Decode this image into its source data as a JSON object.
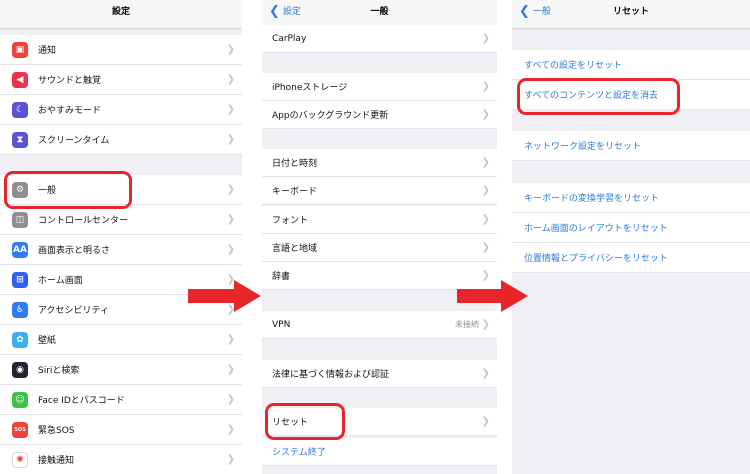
{
  "panel1": {
    "title": "設定",
    "rows": [
      {
        "label": "通知",
        "icon": "notifications-icon",
        "color": "#f0413a",
        "glyph": "▣"
      },
      {
        "label": "サウンドと触覚",
        "icon": "sound-icon",
        "color": "#f0304f",
        "glyph": "◀"
      },
      {
        "label": "おやすみモード",
        "icon": "moon-icon",
        "color": "#5b55d6",
        "glyph": "☾"
      },
      {
        "label": "スクリーンタイム",
        "icon": "hourglass-icon",
        "color": "#5b55d6",
        "glyph": "⧗"
      },
      {
        "label": "一般",
        "icon": "gear-icon",
        "color": "#8e8e93",
        "glyph": "⚙"
      },
      {
        "label": "コントロールセンター",
        "icon": "control-center-icon",
        "color": "#8e8e93",
        "glyph": "◫"
      },
      {
        "label": "画面表示と明るさ",
        "icon": "display-icon",
        "color": "#2f7cf6",
        "glyph": "AA"
      },
      {
        "label": "ホーム画面",
        "icon": "home-screen-icon",
        "color": "#2f5ef0",
        "glyph": "⊞"
      },
      {
        "label": "アクセシビリティ",
        "icon": "accessibility-icon",
        "color": "#2f7cf6",
        "glyph": "♿"
      },
      {
        "label": "壁紙",
        "icon": "wallpaper-icon",
        "color": "#36b0e8",
        "glyph": "✿"
      },
      {
        "label": "Siriと検索",
        "icon": "siri-icon",
        "color": "#222233",
        "glyph": "◉"
      },
      {
        "label": "Face IDとパスコード",
        "icon": "face-id-icon",
        "color": "#3fc24a",
        "glyph": "☺"
      },
      {
        "label": "緊急SOS",
        "icon": "sos-icon",
        "color": "#f0413a",
        "glyph": "SOS"
      },
      {
        "label": "接触通知",
        "icon": "exposure-icon",
        "color": "#ffffff",
        "glyph": "✺"
      }
    ]
  },
  "panel2": {
    "back": "設定",
    "title": "一般",
    "rows": [
      {
        "label": "CarPlay"
      },
      {
        "label": "iPhoneストレージ"
      },
      {
        "label": "Appのバックグラウンド更新"
      },
      {
        "label": "日付と時刻"
      },
      {
        "label": "キーボード"
      },
      {
        "label": "フォント"
      },
      {
        "label": "言語と地域"
      },
      {
        "label": "辞書"
      },
      {
        "label": "VPN",
        "value": "未接続"
      },
      {
        "label": "法律に基づく情報および認証"
      },
      {
        "label": "リセット"
      },
      {
        "label": "システム終了"
      }
    ]
  },
  "panel3": {
    "back": "一般",
    "title": "リセット",
    "rows": [
      {
        "label": "すべての設定をリセット"
      },
      {
        "label": "すべてのコンテンツと設定を消去"
      },
      {
        "label": "ネットワーク設定をリセット"
      },
      {
        "label": "キーボードの変換学習をリセット"
      },
      {
        "label": "ホーム画面のレイアウトをリセット"
      },
      {
        "label": "位置情報とプライバシーをリセット"
      }
    ]
  },
  "colors": {
    "accent": "#2a7ae2",
    "highlight": "#e8252b",
    "arrow": "#e8252b"
  }
}
